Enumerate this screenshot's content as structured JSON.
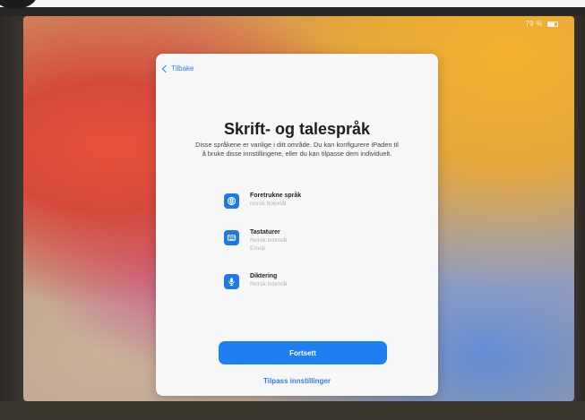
{
  "status_bar": {
    "battery_text": "79 %"
  },
  "sheet": {
    "back_label": "Tilbake",
    "title": "Skrift- og talespråk",
    "description": "Disse språkene er vanlige i ditt område. Du kan konfigurere iPaden til å bruke disse innstillingene, eller du kan tilpasse dem individuelt.",
    "items": [
      {
        "title": "Foretrukne språk",
        "lines": [
          "norsk bokmål"
        ],
        "icon": "globe-icon"
      },
      {
        "title": "Tastaturer",
        "lines": [
          "Norsk bokmål",
          "Emoji"
        ],
        "icon": "keyboard-icon"
      },
      {
        "title": "Diktering",
        "lines": [
          "Norsk bokmål"
        ],
        "icon": "microphone-icon"
      }
    ],
    "primary_button_label": "Fortsett",
    "secondary_link_label": "Tilpass innstillinger"
  },
  "colors": {
    "accent": "#1f7ef0",
    "link": "#2f7eea"
  }
}
